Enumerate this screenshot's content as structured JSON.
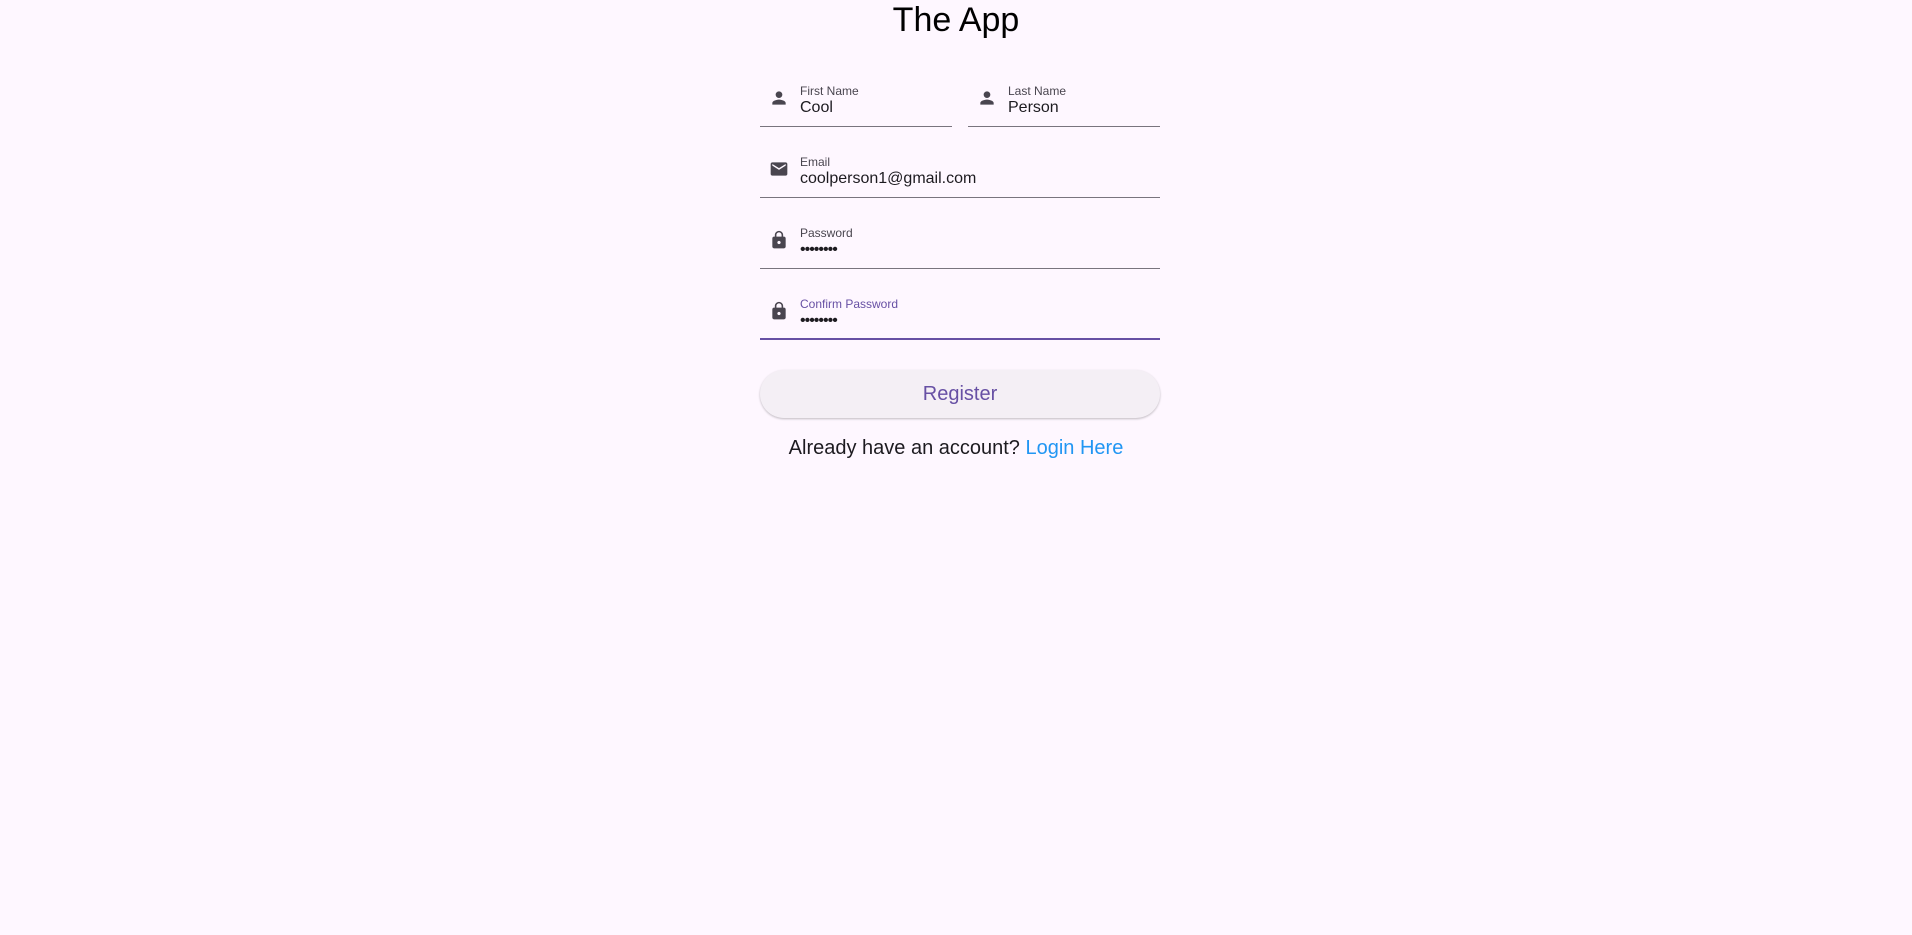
{
  "app": {
    "title": "The App"
  },
  "form": {
    "first_name": {
      "label": "First Name",
      "value": "Cool"
    },
    "last_name": {
      "label": "Last Name",
      "value": "Person"
    },
    "email": {
      "label": "Email",
      "value": "coolperson1@gmail.com"
    },
    "password": {
      "label": "Password",
      "value": "••••••••"
    },
    "confirm_password": {
      "label": "Confirm Password",
      "value": "••••••••"
    },
    "register_label": "Register"
  },
  "footer": {
    "prompt": "Already have an account? ",
    "login_link": "Login Here"
  },
  "icons": {
    "first_name": "person-icon",
    "last_name": "person-icon",
    "email": "mail-icon",
    "password": "lock-icon",
    "confirm_password": "lock-icon"
  },
  "colors": {
    "background": "#fef7ff",
    "accent": "#6750a4",
    "link": "#2196f3"
  }
}
